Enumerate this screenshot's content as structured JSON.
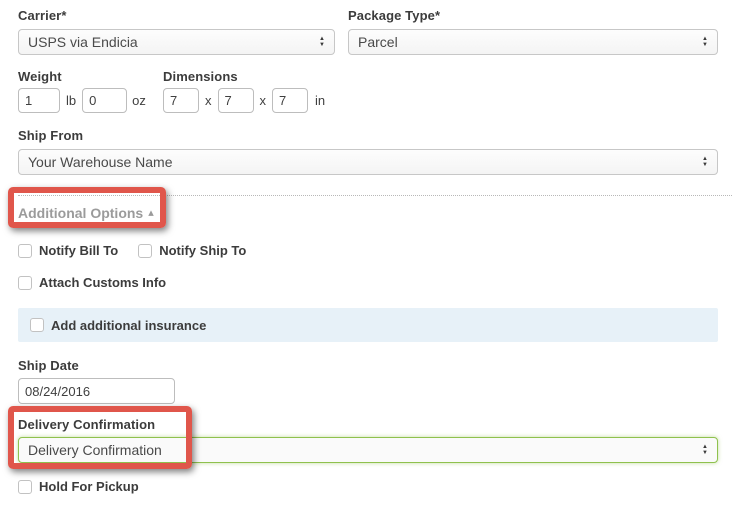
{
  "form": {
    "carrier": {
      "label": "Carrier*",
      "value": "USPS via Endicia"
    },
    "package_type": {
      "label": "Package Type*",
      "value": "Parcel"
    },
    "weight": {
      "label": "Weight",
      "pounds": "1",
      "pounds_unit": "lb",
      "ounces": "0",
      "ounces_unit": "oz"
    },
    "dimensions": {
      "label": "Dimensions",
      "length": "7",
      "width": "7",
      "height": "7",
      "separator": "x",
      "unit": "in"
    },
    "ship_from": {
      "label": "Ship From",
      "value": "Your Warehouse Name"
    },
    "additional_options": {
      "label": "Additional Options",
      "state": "expanded"
    },
    "notify_bill_to": {
      "label": "Notify Bill To",
      "checked": false
    },
    "notify_ship_to": {
      "label": "Notify Ship To",
      "checked": false
    },
    "attach_customs_info": {
      "label": "Attach Customs Info",
      "checked": false
    },
    "add_additional_insurance": {
      "label": "Add additional insurance",
      "checked": false
    },
    "ship_date": {
      "label": "Ship Date",
      "value": "08/24/2016"
    },
    "delivery_confirmation": {
      "label": "Delivery Confirmation",
      "value": "Delivery Confirmation"
    },
    "hold_for_pickup": {
      "label": "Hold For Pickup",
      "checked": false
    }
  },
  "icons": {
    "select_arrow_up": "▲",
    "select_arrow_down": "▼",
    "collapse_arrow": "▴"
  },
  "colors": {
    "annotation_red": "#e0564b",
    "insurance_highlight_bg": "#e7f1f8",
    "delivery_select_border": "#8fc14e"
  }
}
